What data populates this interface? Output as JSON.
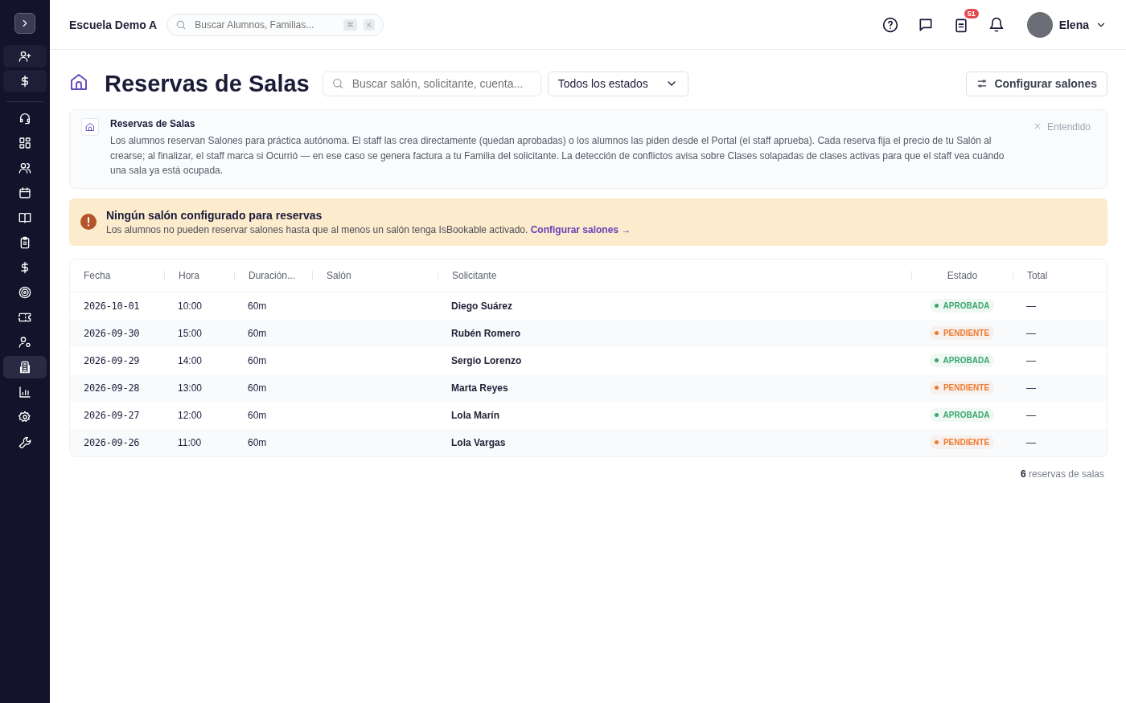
{
  "sidebar": {
    "items": [
      {
        "selected": false
      },
      {
        "selected": false
      },
      {
        "selected": false
      },
      {
        "selected": false
      },
      {
        "selected": false
      },
      {
        "selected": false
      },
      {
        "selected": false
      },
      {
        "selected": false
      },
      {
        "selected": false
      },
      {
        "selected": false
      },
      {
        "selected": false
      },
      {
        "selected": false
      },
      {
        "selected": true
      },
      {
        "selected": false
      },
      {
        "selected": false
      },
      {
        "selected": false
      }
    ]
  },
  "topbar": {
    "school": "Escuela Demo A",
    "search": {
      "placeholder": "Buscar Alumnos, Familias...",
      "keys": [
        "⌘",
        "K"
      ]
    },
    "tasks_badge": "51",
    "user": "Elena"
  },
  "header": {
    "title": "Reservas de Salas",
    "search": {
      "placeholder": "Buscar salón, solicitante, cuenta..."
    },
    "filter": "Todos los estados",
    "action": "Configurar salones"
  },
  "info": {
    "title": "Reservas de Salas",
    "body": "Los alumnos reservan Salones para práctica autónoma. El staff las crea directamente (quedan aprobadas) o los alumnos las piden desde el Portal (el staff aprueba). Cada reserva fija el precio de tu Salón al crearse; al finalizar, el staff marca si Ocurrió — en ese caso se genera factura a tu Familia del solicitante. La detección de conflictos avisa sobre Clases solapadas de clases activas para que el staff vea cuándo una sala ya está ocupada.",
    "dismiss": "Entendido"
  },
  "warning": {
    "title": "Ningún salón configurado para reservas",
    "body": "Los alumnos no pueden reservar salones hasta que al menos un salón tenga IsBookable activado.",
    "link": "Configurar salones →"
  },
  "table": {
    "columns": [
      "Fecha",
      "Hora",
      "Duración...",
      "Salón",
      "Solicitante",
      "Estado",
      "Total"
    ],
    "rows": [
      {
        "fecha": "2026-10-01",
        "hora": "10:00",
        "duracion": "60m",
        "solicitante": "Diego Suárez",
        "estado": "APROBADA",
        "color": "#3aa76d",
        "total": "—"
      },
      {
        "fecha": "2026-09-30",
        "hora": "15:00",
        "duracion": "60m",
        "solicitante": "Rubén Romero",
        "estado": "PENDIENTE",
        "color": "#ee7a2f",
        "total": "—"
      },
      {
        "fecha": "2026-09-29",
        "hora": "14:00",
        "duracion": "60m",
        "solicitante": "Sergio Lorenzo",
        "estado": "APROBADA",
        "color": "#3aa76d",
        "total": "—"
      },
      {
        "fecha": "2026-09-28",
        "hora": "13:00",
        "duracion": "60m",
        "solicitante": "Marta Reyes",
        "estado": "PENDIENTE",
        "color": "#ee7a2f",
        "total": "—"
      },
      {
        "fecha": "2026-09-27",
        "hora": "12:00",
        "duracion": "60m",
        "solicitante": "Lola Marín",
        "estado": "APROBADA",
        "color": "#3aa76d",
        "total": "—"
      },
      {
        "fecha": "2026-09-26",
        "hora": "11:00",
        "duracion": "60m",
        "solicitante": "Lola Vargas",
        "estado": "PENDIENTE",
        "color": "#ee7a2f",
        "total": "—"
      }
    ]
  },
  "footer": "**6** reservas de salas"
}
